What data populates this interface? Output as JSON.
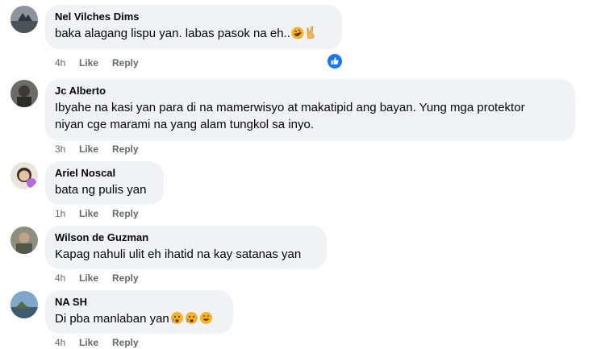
{
  "comments": [
    {
      "author": "Nel Vilches Dims",
      "text": "baka alagang lispu yan. labas pasok na eh..",
      "emojis": [
        "rolling-on-floor-laughing-emoji",
        "victory-hand-emoji"
      ],
      "time": "4h",
      "like_label": "Like",
      "reply_label": "Reply",
      "reaction": "like-reaction-icon"
    },
    {
      "author": "Jc Alberto",
      "text_lines": [
        "Ibyahe na kasi yan para di na mamerwisyo at makatipid ang bayan. Yung mga protektor",
        "niyan cge marami na yang alam tungkol sa inyo."
      ],
      "time": "3h",
      "like_label": "Like",
      "reply_label": "Reply"
    },
    {
      "author": "Ariel Noscal",
      "text": "bata ng pulis yan",
      "time": "1h",
      "like_label": "Like",
      "reply_label": "Reply"
    },
    {
      "author": "Wilson de Guzman",
      "text": "Kapag nahuli ulit eh ihatid na kay satanas yan",
      "time": "4h",
      "like_label": "Like",
      "reply_label": "Reply"
    },
    {
      "author": "NA SH",
      "text": "Di pba manlaban yan",
      "emojis": [
        "crying-face-emoji",
        "crying-face-emoji",
        "grinning-face-emoji"
      ],
      "time": "4h",
      "like_label": "Like",
      "reply_label": "Reply"
    }
  ],
  "colors": {
    "bubble": "#f0f2f5",
    "text": "#050505",
    "meta": "#65676b",
    "like_blue": "#1877f2"
  }
}
